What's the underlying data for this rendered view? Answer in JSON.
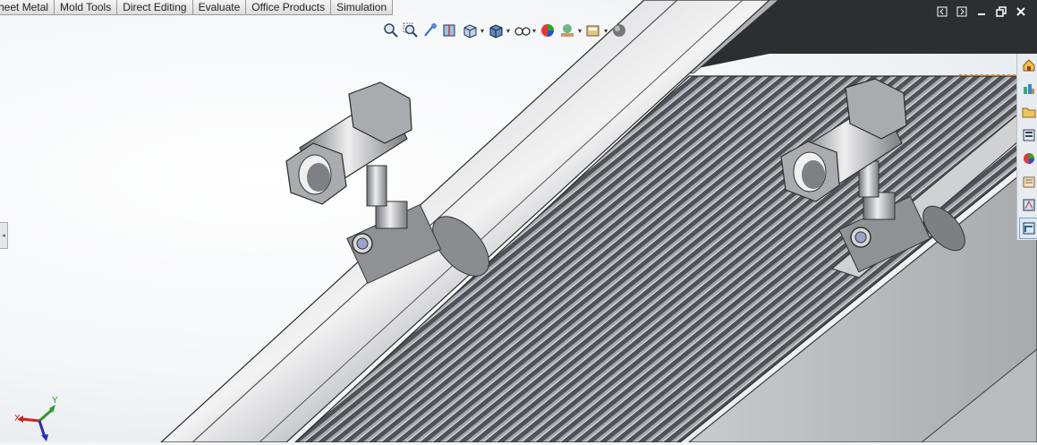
{
  "tabs": [
    "heet Metal",
    "Mold Tools",
    "Direct Editing",
    "Evaluate",
    "Office Products",
    "Simulation"
  ],
  "hud": {
    "buttons": [
      "zoom-to-fit-icon",
      "zoom-to-area-icon",
      "previous-view-icon",
      "section-view-icon",
      "view-orientation-icon",
      "display-style-icon",
      "hide-show-items-icon",
      "edit-appearance-icon",
      "apply-scene-icon",
      "view-settings-icon",
      "realview-icon"
    ]
  },
  "window_controls": [
    "tile-left-icon",
    "tile-right-icon",
    "minimize-icon",
    "restore-icon",
    "close-icon"
  ],
  "task_pane": [
    "home-icon",
    "resources-icon",
    "design-library-icon",
    "file-explorer-icon",
    "appearances-icon",
    "custom-properties-icon",
    "view-palette-icon",
    "routing-library-icon"
  ],
  "triad": {
    "x_label": "X",
    "y_label": "Y",
    "x_color": "#d42020",
    "y_color": "#2a9a2a",
    "z_color": "#2030c0"
  }
}
